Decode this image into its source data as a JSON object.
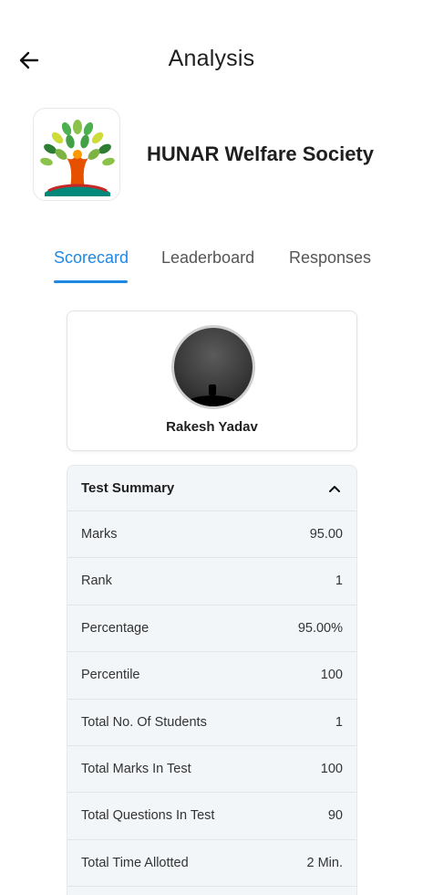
{
  "header": {
    "title": "Analysis"
  },
  "org": {
    "name": "HUNAR Welfare Society"
  },
  "tabs": [
    {
      "label": "Scorecard",
      "active": true
    },
    {
      "label": "Leaderboard",
      "active": false
    },
    {
      "label": "Responses",
      "active": false
    }
  ],
  "profile": {
    "name": "Rakesh Yadav"
  },
  "summary": {
    "title": "Test Summary",
    "expanded": true,
    "rows": [
      {
        "label": "Marks",
        "value": "95.00"
      },
      {
        "label": "Rank",
        "value": "1"
      },
      {
        "label": "Percentage",
        "value": "95.00%"
      },
      {
        "label": "Percentile",
        "value": "100"
      },
      {
        "label": "Total No. Of Students",
        "value": "1"
      },
      {
        "label": "Total Marks In Test",
        "value": "100"
      },
      {
        "label": "Total Questions In Test",
        "value": "90"
      },
      {
        "label": "Total Time Allotted",
        "value": "2 Min."
      }
    ]
  },
  "colors": {
    "accent": "#1e88e5",
    "summary_bg": "#f3f6f9"
  },
  "icons": {
    "back": "arrow-left-icon",
    "collapse": "chevron-up-icon"
  }
}
